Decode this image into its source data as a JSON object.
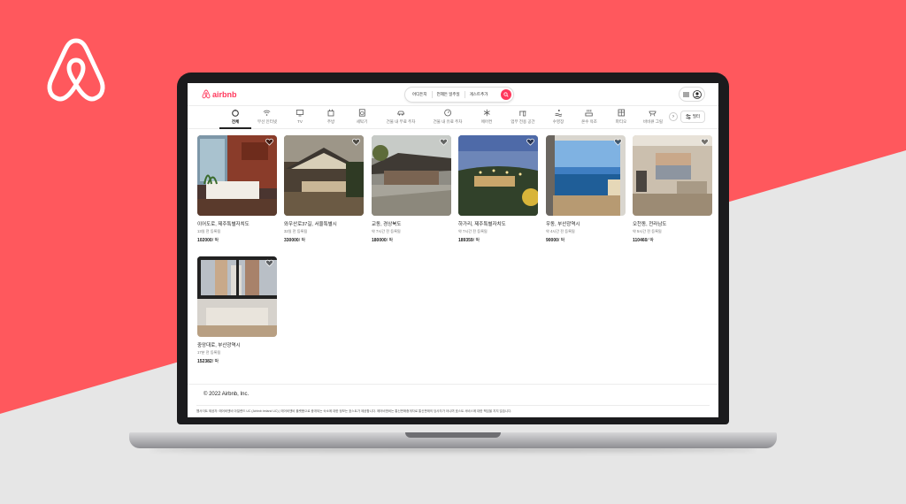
{
  "brand": {
    "accent": "#ff385c",
    "background_coral": "#ff585d",
    "background_grey": "#e6e6e6",
    "logo_icon": "airbnb-belo-icon"
  },
  "header": {
    "logo_text": "airbnb",
    "search": {
      "where": "어디든지",
      "when": "언제든 일주일",
      "guests": "게스트추가",
      "search_icon": "search-icon"
    },
    "menu_icon": "menu-icon",
    "user_icon": "user-icon"
  },
  "categories": {
    "items": [
      {
        "label": "전체",
        "icon": "all-icon",
        "active": true
      },
      {
        "label": "무선 인터넷",
        "icon": "wifi-icon"
      },
      {
        "label": "TV",
        "icon": "tv-icon"
      },
      {
        "label": "주방",
        "icon": "kitchen-icon"
      },
      {
        "label": "세탁기",
        "icon": "washer-icon"
      },
      {
        "label": "건물 내 무료 주차",
        "icon": "car-icon"
      },
      {
        "label": "건물 내 유료 주차",
        "icon": "parking-meter-icon"
      },
      {
        "label": "에어컨",
        "icon": "snowflake-icon"
      },
      {
        "label": "업무 전용 공간",
        "icon": "desk-icon"
      },
      {
        "label": "수영장",
        "icon": "pool-icon"
      },
      {
        "label": "온수 욕조",
        "icon": "hot-tub-icon"
      },
      {
        "label": "파티오",
        "icon": "patio-icon"
      },
      {
        "label": "바비큐 그릴",
        "icon": "grill-icon"
      }
    ],
    "next_arrow": "›",
    "filter_label": "필터"
  },
  "listings": [
    {
      "title": "이어도로, 제주특별자치도",
      "sub": "13일 전 등록됨",
      "price": "102000",
      "unit": "/ 박"
    },
    {
      "title": "와우산로37길, 서울특별시",
      "sub": "32일 전 등록됨",
      "price": "330000",
      "unit": "/ 박"
    },
    {
      "title": "교동, 경상북도",
      "sub": "약 7시간 전 등록됨",
      "price": "180000",
      "unit": "/ 박"
    },
    {
      "title": "하가리, 제주특별자치도",
      "sub": "약 7시간 전 등록됨",
      "price": "189359",
      "unit": "/ 박"
    },
    {
      "title": "우동, 부산광역시",
      "sub": "약 4시간 전 등록됨",
      "price": "90000",
      "unit": "/ 박"
    },
    {
      "title": "오천동, 전라남도",
      "sub": "약 5시간 전 등록됨",
      "price": "110460",
      "unit": "/ 박"
    },
    {
      "title": "중앙대로, 부산광역시",
      "sub": "17분 전 등록됨",
      "price": "152382",
      "unit": "/ 박"
    }
  ],
  "footer": {
    "copyright": "© 2022 Airbnb, Inc.",
    "note": "웹사이트 제공자: 에어비앤비 아일랜드 UC (Airbnb Ireland UC) | 에어비앤비 플랫폼으로 중개되는 숙소에 대한 정보는 호스트가 제공합니다. 에어비앤비는 통신판매중개자로 통신판매의 당사자가 아니며 호스트 서비스에 대한 책임을 지지 않습니다."
  }
}
